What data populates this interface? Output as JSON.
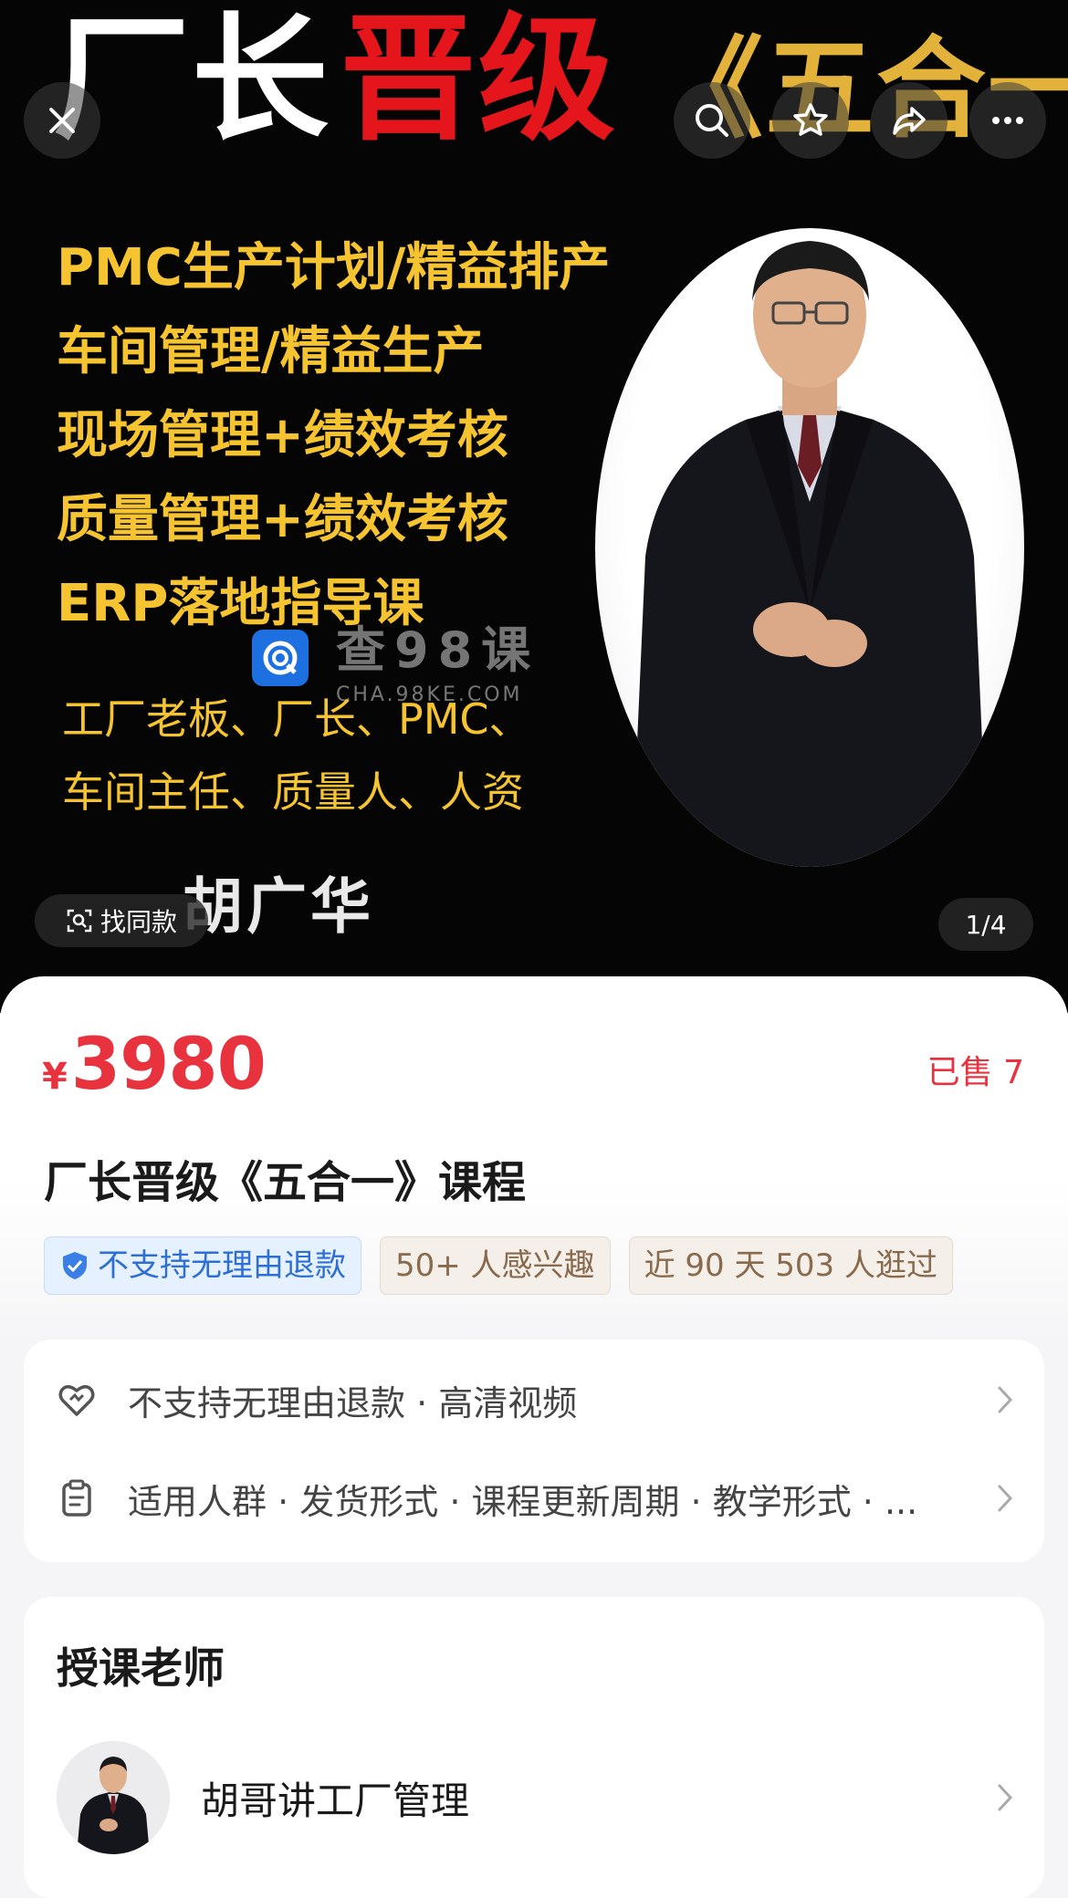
{
  "hero": {
    "title_white": "厂长",
    "title_red": "晋级",
    "title_gold": "《五合一》",
    "lines": [
      "PMC生产计划/精益排产",
      "车间管理/精益生产",
      "现场管理+绩效考核",
      "质量管理+绩效考核",
      "ERP落地指导课"
    ],
    "audience": [
      "工厂老板、厂长、PMC、",
      "车间主任、质量人、人资"
    ],
    "teacher_name": "胡广华",
    "watermark_main": "查98课",
    "watermark_sub": "CHA.98KE.COM",
    "find_same": "找同款",
    "page_indicator": "1/4"
  },
  "top_actions": [
    "close-icon",
    "search-icon",
    "favorite-icon",
    "share-icon",
    "more-icon"
  ],
  "product": {
    "currency": "¥",
    "price": "3980",
    "sold": "已售 7",
    "title": "厂长晋级《五合一》课程",
    "tags": [
      {
        "text": "不支持无理由退款",
        "style": "blue"
      },
      {
        "text": "50+ 人感兴趣",
        "style": "brown"
      },
      {
        "text": "近 90 天 503 人逛过",
        "style": "brown"
      }
    ]
  },
  "services": [
    {
      "icon": "heart-shield-icon",
      "text": "不支持无理由退款 · 高清视频"
    },
    {
      "icon": "clipboard-icon",
      "text": "适用人群 · 发货形式 · 课程更新周期 · 教学形式 · ..."
    }
  ],
  "teacher": {
    "heading": "授课老师",
    "name": "胡哥讲工厂管理"
  },
  "colors": {
    "price_red": "#e8323e",
    "hero_gold": "#f5c430",
    "hero_red": "#e4161c",
    "tag_blue": "#2d6fd4",
    "tag_brown": "#8a6a4d"
  }
}
